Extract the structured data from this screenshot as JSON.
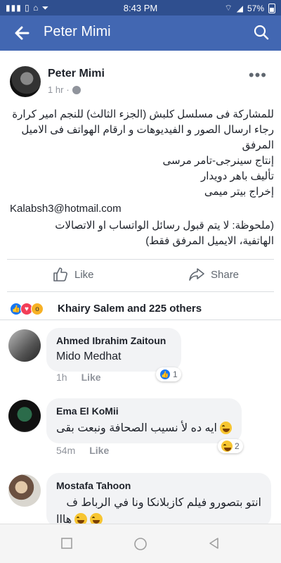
{
  "status_bar": {
    "left_icons": "▮▮▮ ▯ ⌂ ⏷",
    "time": "8:43 PM",
    "battery": "57%"
  },
  "nav": {
    "title": "Peter Mimi"
  },
  "post": {
    "author": "Peter Mimi",
    "time": "1 hr",
    "body_lines": [
      "للمشاركة فى مسلسل كلبش (الجزء الثالث) للنجم امير كرارة",
      "رجاء ارسال الصور و الفيديوهات و ارقام الهواتف فى الاميل",
      "المرفق",
      "إنتاج سينرجى-تامر مرسى",
      "تأليف باهر دويدار",
      "إخراج بيتر ميمى"
    ],
    "email": "Kalabsh3@hotmail.com",
    "note_lines": [
      "(ملحوظة: لا يتم قبول رسائل الواتساب او الاتصالات",
      "الهاتفية، الايميل المرفق فقط)"
    ],
    "like_label": "Like",
    "share_label": "Share",
    "reactions_text": "Khairy Salem and 225 others"
  },
  "comments": [
    {
      "name": "Ahmed Ibrahim Zaitoun",
      "text": "Mido Medhat",
      "time": "1h",
      "like_label": "Like",
      "reaction_count": "1"
    },
    {
      "name": "Ema El KoMii",
      "text": "ايه ده لأ نسيب الصحافة  ونبعت بقى",
      "time": "54m",
      "like_label": "Like",
      "reaction_count": "2"
    },
    {
      "name": "Mostafa Tahoon",
      "text_lines": [
        "انتو بتصورو فيلم كازبلانكا ونا في الرباط ف",
        "هااا"
      ]
    }
  ],
  "colors": {
    "status_bar": "#2f4f8f",
    "nav_bar": "#4267b2",
    "like_blue": "#1877f2"
  }
}
